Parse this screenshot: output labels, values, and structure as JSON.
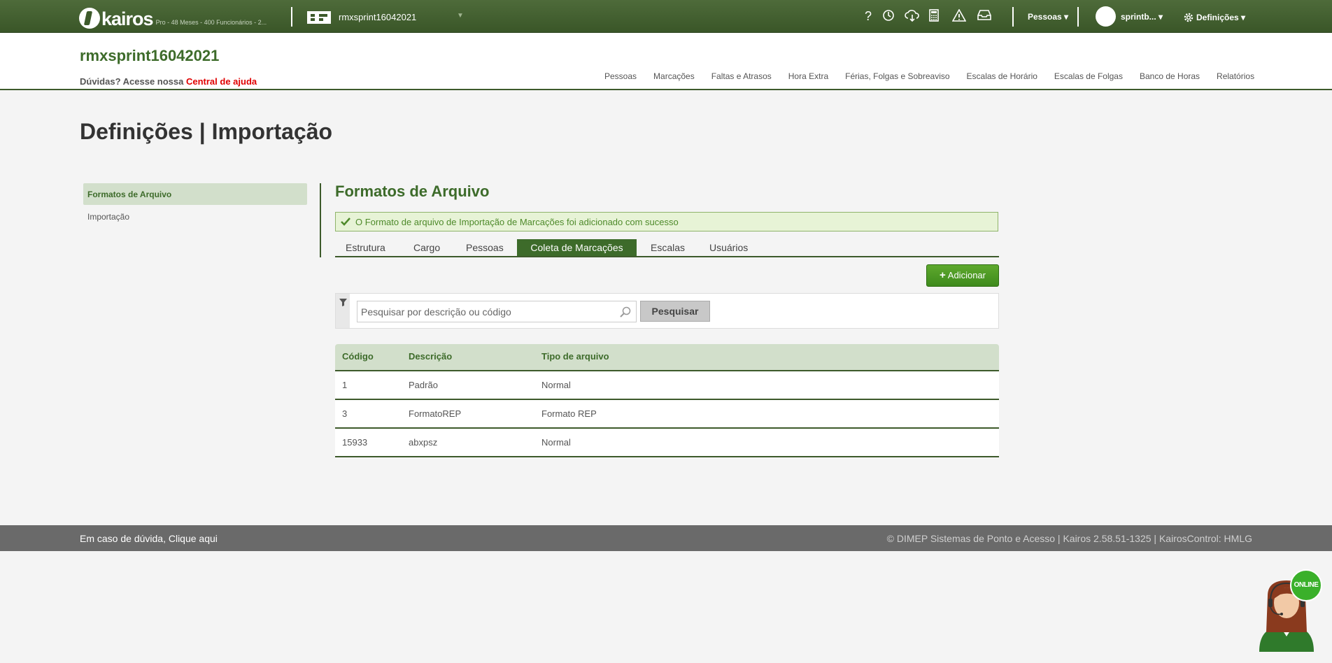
{
  "topbar": {
    "logo_text": "kairos",
    "plan_info": "Pro - 48 Meses - 400 Funcionários - 2...",
    "company_selector": "rmxsprint16042021",
    "help_icon": "?",
    "pessoas_menu": "Pessoas",
    "user_menu": "sprintb...",
    "settings_menu": "Definições",
    "icons": [
      "help-icon",
      "clock-refresh-icon",
      "cloud-download-icon",
      "calculator-icon",
      "warning-icon",
      "inbox-icon",
      "gear-icon"
    ]
  },
  "header": {
    "company_title": "rmxsprint16042021",
    "help_prefix": "Dúvidas? Acesse nossa ",
    "help_link": "Central de ajuda",
    "nav": [
      "Pessoas",
      "Marcações",
      "Faltas e Atrasos",
      "Hora Extra",
      "Férias, Folgas e Sobreaviso",
      "Escalas de Horário",
      "Escalas de Folgas",
      "Banco de Horas",
      "Relatórios"
    ]
  },
  "page_title": "Definições | Importação",
  "sidebar": {
    "items": [
      {
        "label": "Formatos de Arquivo",
        "active": true
      },
      {
        "label": "Importação",
        "active": false
      }
    ]
  },
  "content": {
    "section_title": "Formatos de Arquivo",
    "alert": "O Formato de arquivo de Importação de Marcações foi adicionado com sucesso",
    "tabs": [
      {
        "label": "Estrutura",
        "active": false
      },
      {
        "label": "Cargo",
        "active": false
      },
      {
        "label": "Pessoas",
        "active": false
      },
      {
        "label": "Coleta de Marcações",
        "active": true
      },
      {
        "label": "Escalas",
        "active": false
      },
      {
        "label": "Usuários",
        "active": false
      }
    ],
    "add_button": "Adicionar",
    "add_button_icon": "+",
    "search_placeholder": "Pesquisar por descrição ou código",
    "search_value": "",
    "search_button": "Pesquisar",
    "table": {
      "headers": [
        "Código",
        "Descrição",
        "Tipo de arquivo"
      ],
      "rows": [
        [
          "1",
          "Padrão",
          "Normal"
        ],
        [
          "3",
          "FormatoREP",
          "Formato REP"
        ],
        [
          "15933",
          "abxpsz",
          "Normal"
        ]
      ]
    }
  },
  "footer": {
    "left": "Em caso de dúvida, Clique aqui",
    "right": "© DIMEP Sistemas de Ponto e Acesso | Kairos 2.58.51-1325 | KairosControl: HMLG"
  },
  "support": {
    "badge": "ONLINE"
  },
  "colors": {
    "brand_green": "#3d6b2a",
    "topbar_green": "#3a5628",
    "alert_bg": "#e7f3d6",
    "link_red": "#e00000",
    "footer_gray": "#6a6a6a"
  }
}
